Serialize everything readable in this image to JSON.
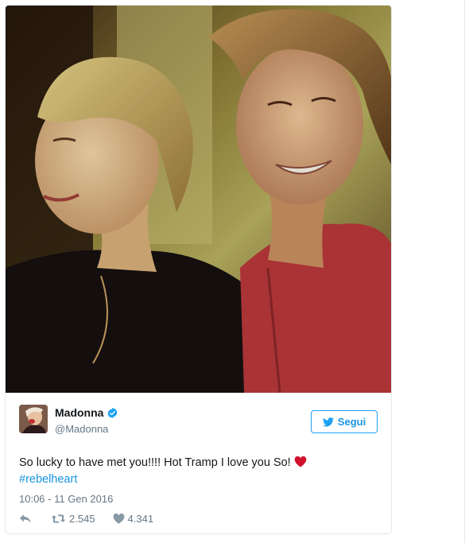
{
  "tweet": {
    "display_name": "Madonna",
    "handle": "@Madonna",
    "follow_label": "Segui",
    "text": "So lucky to have met you!!!! Hot Tramp I love you So!",
    "hashtag": "#rebelheart",
    "timestamp": "10:06 - 11 Gen 2016",
    "retweet_count": "2.545",
    "like_count": "4.341"
  },
  "icons": {
    "verified": "verified-badge-icon",
    "follow": "twitter-bird-icon",
    "heart_emoji": "red-heart-icon",
    "reply": "reply-arrow-icon",
    "retweet": "retweet-icon",
    "like": "heart-icon"
  },
  "colors": {
    "link": "#1b95e0",
    "verified": "#1da1f2",
    "muted_text": "#657786",
    "heart": "#e0245e"
  }
}
